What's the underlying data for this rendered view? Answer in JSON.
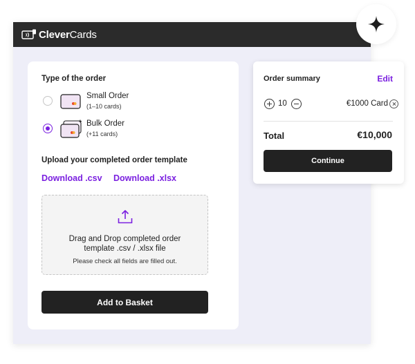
{
  "app": {
    "brand_bold": "Clever",
    "brand_rest": "Cards",
    "icons": {
      "logo": "card-reader-logo-icon",
      "badge": "sparkle-icon"
    }
  },
  "order": {
    "type_title": "Type of the order",
    "options": [
      {
        "label": "Small Order",
        "sub": "(1–10 cards)",
        "selected": false,
        "icon": "single-card-icon"
      },
      {
        "label": "Bulk Order",
        "sub": "(+11 cards)",
        "selected": true,
        "icon": "stacked-cards-icon"
      }
    ],
    "upload_title": "Upload your completed order template",
    "download_csv": "Download .csv",
    "download_xlsx": "Download .xlsx",
    "dropzone": {
      "line1": "Drag and Drop completed order",
      "line2": "template .csv / .xlsx file",
      "hint": "Please check all fields are filled out.",
      "icon": "upload-icon"
    },
    "add_button": "Add to Basket"
  },
  "summary": {
    "title": "Order summary",
    "edit": "Edit",
    "quantity": "10",
    "item": "€1000 Card",
    "total_label": "Total",
    "total_value": "€10,000",
    "continue": "Continue"
  },
  "colors": {
    "accent": "#7a1fe0",
    "dark": "#222222",
    "titlebar": "#2b2b2b",
    "window_bg": "#eeeef8",
    "card_pink": "#f1e4f4"
  }
}
